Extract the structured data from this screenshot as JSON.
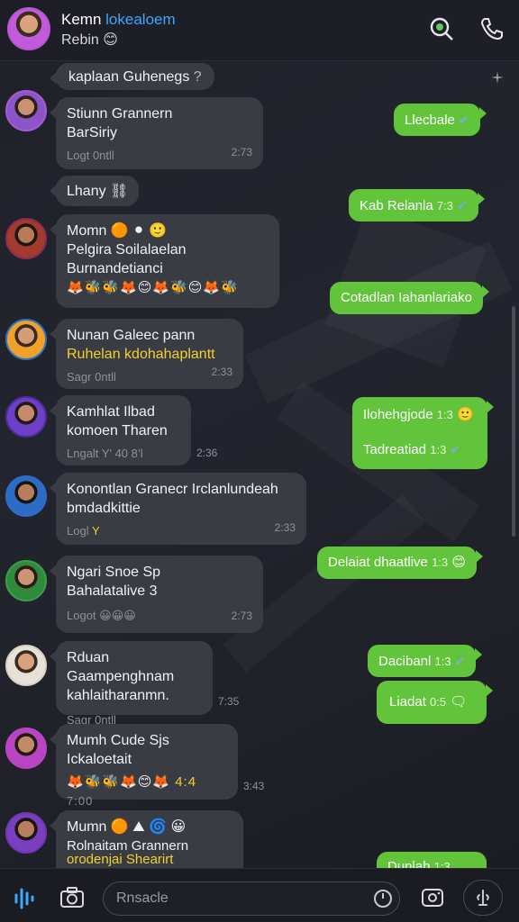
{
  "header": {
    "title_main": "Kemn",
    "title_accent": "lokealoem",
    "subtitle": "Rebin",
    "subtitle_emoji": "😊"
  },
  "messages": {
    "m1": {
      "text": "kaplaan Guhenegs",
      "emoji": "?"
    },
    "m2": {
      "line1": "Stiunn Grannern",
      "line2": "BarSiriy",
      "sender": "Logt",
      "meta": "0ntll",
      "time": "2:73"
    },
    "m3": {
      "text": "Llecbale"
    },
    "m4": {
      "text": "Lhany",
      "emoji": "⛓"
    },
    "m5": {
      "text": "Kab Relanla",
      "time": "7:3"
    },
    "m6": {
      "line1": "Momn",
      "line1_emoji": "🟠 ⚫ 🙂",
      "line2": "Pelgira",
      "line2_mid": "Soilalaelan",
      "line2_emoji": "🐝😊🐝😊",
      "line3": "Burnandetianci",
      "emojis": "🦊🐝🐝🦊😊🦊🐝😊🦊🐝"
    },
    "m7": {
      "text": "Cotadlan Iahanlariako"
    },
    "m8": {
      "line1": "Nunan Galeec pann",
      "line2": "Ruhelan kdohahaplantt",
      "sender": "Sagr",
      "meta": "0ntll",
      "time": "2:33"
    },
    "m9": {
      "line1": "Kamhlat Ilbad",
      "line2": "komoen Tharen",
      "sender": "Lngalt",
      "meta": "Y' 40 8’l",
      "time": "2:36"
    },
    "m10": {
      "line1": "Ilohehgjode",
      "time1": "1:3",
      "line2": "Tadreatiad",
      "time2": "1:3"
    },
    "m11": {
      "line1": "Konontlan Granecr Irclanlundeah",
      "line2": "bmdadkittie",
      "sender": "Logl",
      "time": "2:33"
    },
    "m12": {
      "text": "Delaiat dhaatlive",
      "time": "1:3"
    },
    "m13": {
      "line1": "Ngari Snoe",
      "line1_suffix": "Sp",
      "line2": "Bahalatalive",
      "line2_suffix": "3",
      "sender": "Logot",
      "time": "2:73"
    },
    "m14": {
      "text": "Dacibanl",
      "time": "1:3"
    },
    "m15": {
      "line1": "Rduan Gaampenghnam",
      "line2": "kahlaitharanmn.",
      "sender": "Sagr",
      "meta": "0ntll",
      "time": "7:35"
    },
    "m16": {
      "text": "Liadat",
      "time": "0:5"
    },
    "m17": {
      "line1": "Mumh Cude",
      "line1_suffix": "Sjs",
      "line2": "Ickaloetait",
      "emojis": "🦊🐝🐝🦊😊🦊",
      "count": "4:4",
      "time1": "7:00",
      "time2": "3:43"
    },
    "m18": {
      "line1": "Mumn",
      "line2": "Rolnaitam Grannern",
      "line3": "orodenjai Shearirt"
    },
    "m19": {
      "text": "Dunlah",
      "time": "1:3"
    }
  },
  "footer": {
    "placeholder": "Rnsacle"
  },
  "colors": {
    "background": "#1b1c22",
    "incoming_bubble": "#3a3c44",
    "outgoing_bubble": "#62c43a",
    "accent_blue": "#3ba7ff",
    "highlight_yellow": "#f3cf2e"
  }
}
